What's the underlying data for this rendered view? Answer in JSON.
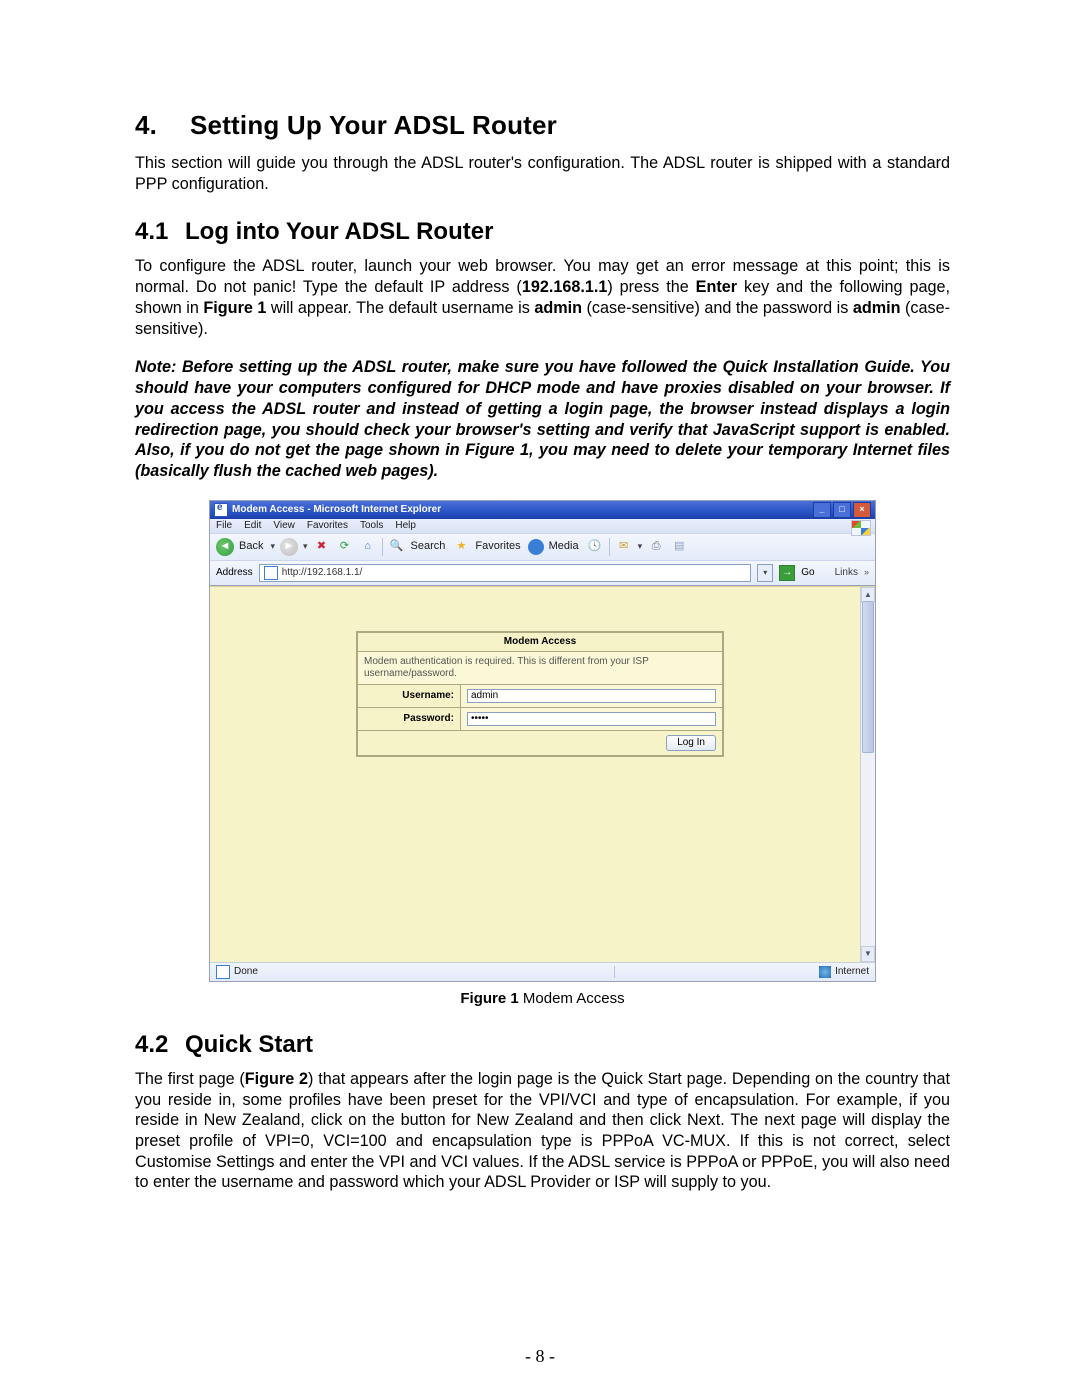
{
  "section4": {
    "num": "4.",
    "title": "Setting Up Your ADSL Router",
    "intro": "This section will guide you through the ADSL router's configuration.  The ADSL router is shipped with a standard PPP configuration."
  },
  "section41": {
    "num": "4.1",
    "title": "Log into Your ADSL Router",
    "para_parts": {
      "a": "To configure the ADSL router, launch your web browser.  You may get an error message at this point; this is normal.  Do not panic!  Type the default IP address (",
      "ip": "192.168.1.1",
      "b": ") press the ",
      "enter": "Enter",
      "c": " key and the following page, shown in ",
      "fig": "Figure 1",
      "d": " will appear.   The default username is ",
      "user": "admin",
      "e": " (case-sensitive) and the password is ",
      "pass": "admin",
      "f": " (case-sensitive)."
    },
    "note": "Note: Before setting up the ADSL router, make sure you have followed the Quick Installation Guide.  You should have your computers configured for DHCP mode and have proxies disabled on your browser.  If you access the ADSL router and instead of getting a login page, the browser instead displays a login redirection page, you should check your browser's setting and verify that JavaScript support is enabled.  Also, if you do not get the page shown in Figure 1, you may need to delete your temporary Internet files (basically flush the cached web pages)."
  },
  "figure1": {
    "label_bold": "Figure 1",
    "label_rest": " Modem Access"
  },
  "section42": {
    "num": "4.2",
    "title": "Quick Start",
    "para_parts": {
      "a": "The first page (",
      "fig": "Figure 2",
      "b": ") that appears after the login page is the Quick Start page.  Depending on the country that you reside in, some profiles have been preset for the VPI/VCI and type of encapsulation.  For example, if you reside in New Zealand, click on the button for New Zealand and then click Next.  The next page will display the preset profile of VPI=0, VCI=100 and encapsulation type is PPPoA VC-MUX.  If this is not correct, select Customise Settings and enter the VPI and VCI values.  If the ADSL service is PPPoA or PPPoE, you will also need to enter the username and password which your ADSL Provider or ISP will supply to you."
    }
  },
  "ie": {
    "title": "Modem Access - Microsoft Internet Explorer",
    "menu": [
      "File",
      "Edit",
      "View",
      "Favorites",
      "Tools",
      "Help"
    ],
    "toolbar": {
      "back": "Back",
      "search": "Search",
      "favorites": "Favorites",
      "media": "Media"
    },
    "address_label": "Address",
    "address_value": "http://192.168.1.1/",
    "go_label": "Go",
    "links_label": "Links",
    "login": {
      "title": "Modem Access",
      "note": "Modem authentication is required. This is different from your ISP username/password.",
      "username_label": "Username:",
      "username_value": "admin",
      "password_label": "Password:",
      "password_value": "•••••",
      "button": "Log In"
    },
    "status_done": "Done",
    "status_zone": "Internet"
  },
  "page_number": "- 8 -"
}
